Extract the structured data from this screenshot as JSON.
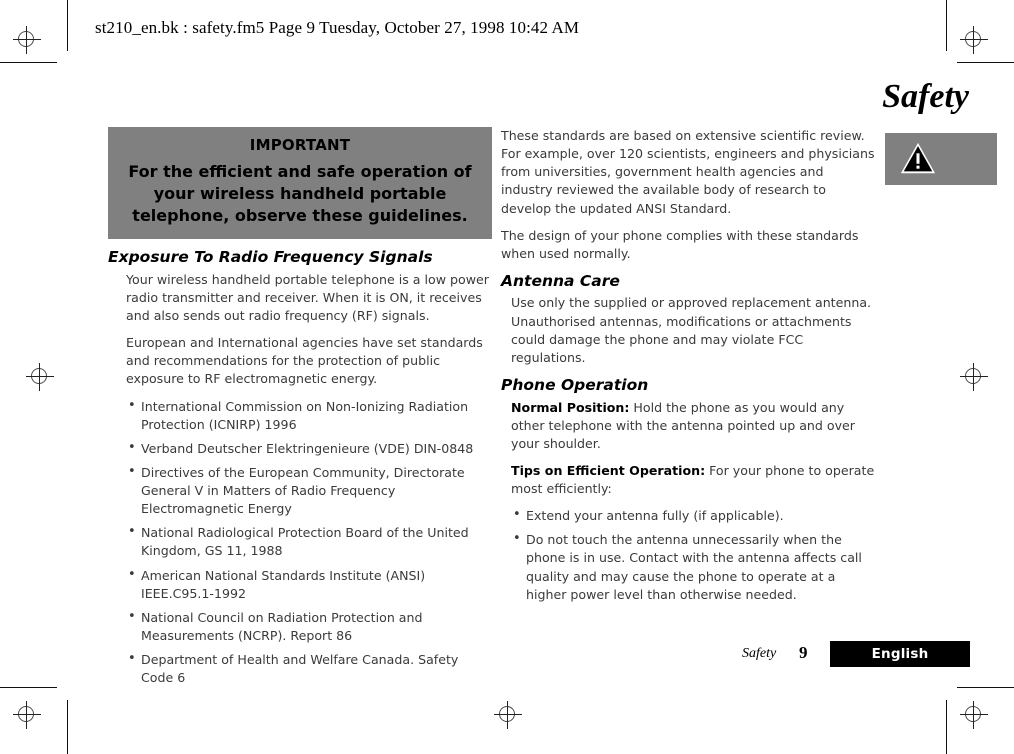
{
  "page_header": "st210_en.bk : safety.fm5  Page 9  Tuesday, October 27, 1998  10:42 AM",
  "title": "Safety",
  "colors": {
    "panel_gray": "#808080",
    "body_text": "#3a3a3a",
    "heading": "#000000",
    "badge_bg": "#000000",
    "badge_text": "#ffffff"
  },
  "important_box": {
    "heading": "IMPORTANT",
    "body": "For the efficient and safe operation of your wireless handheld portable telephone, observe these guidelines."
  },
  "left_column": {
    "section_heading": "Exposure To Radio Frequency Signals",
    "paragraphs": [
      "Your wireless handheld portable telephone is a low power radio transmitter and receiver. When it is ON, it receives and also sends out radio frequency (RF) signals.",
      "European and International agencies have set standards and recommendations for the protection of public exposure to RF electromagnetic energy."
    ],
    "bullets": [
      "International Commission on Non-Ionizing Radiation Protection (ICNIRP) 1996",
      "Verband Deutscher Elektringenieure (VDE) DIN-0848",
      "Directives of the European Community, Directorate General V in Matters of Radio Frequency Electromagnetic Energy",
      "National Radiological Protection Board of the United Kingdom, GS 11, 1988",
      "American National Standards Institute (ANSI) IEEE.C95.1-1992",
      "National Council on Radiation Protection and Measurements (NCRP). Report 86",
      "Department of Health and Welfare Canada. Safety Code 6"
    ]
  },
  "right_column": {
    "intro_paragraphs": [
      "These standards are based on extensive scientific review. For example, over 120 scientists, engineers and physicians from universities, government health agencies and industry reviewed the available body of research to develop the updated ANSI Standard.",
      "The design of your phone complies with these standards when used normally."
    ],
    "antenna_care": {
      "heading": "Antenna Care",
      "paragraph": "Use only the supplied or approved replacement antenna. Unauthorised antennas, modifications or attachments could damage the phone and may violate FCC regulations."
    },
    "phone_operation": {
      "heading": "Phone Operation",
      "normal_position_label": "Normal Position:",
      "normal_position_text": " Hold the phone as you would any other telephone with the antenna pointed up and over your shoulder.",
      "tips_label": "Tips on Efficient Operation:",
      "tips_text": " For your phone to operate most efficiently:",
      "bullets": [
        "Extend your antenna fully (if applicable).",
        "Do not touch the antenna unnecessarily when the phone is in use. Contact with the antenna affects call quality and may cause the phone to operate at a higher power level than otherwise needed."
      ]
    }
  },
  "warning_panel": {
    "icon": "warning-triangle-icon"
  },
  "footer": {
    "section": "Safety",
    "page_number": "9",
    "language": "English"
  }
}
